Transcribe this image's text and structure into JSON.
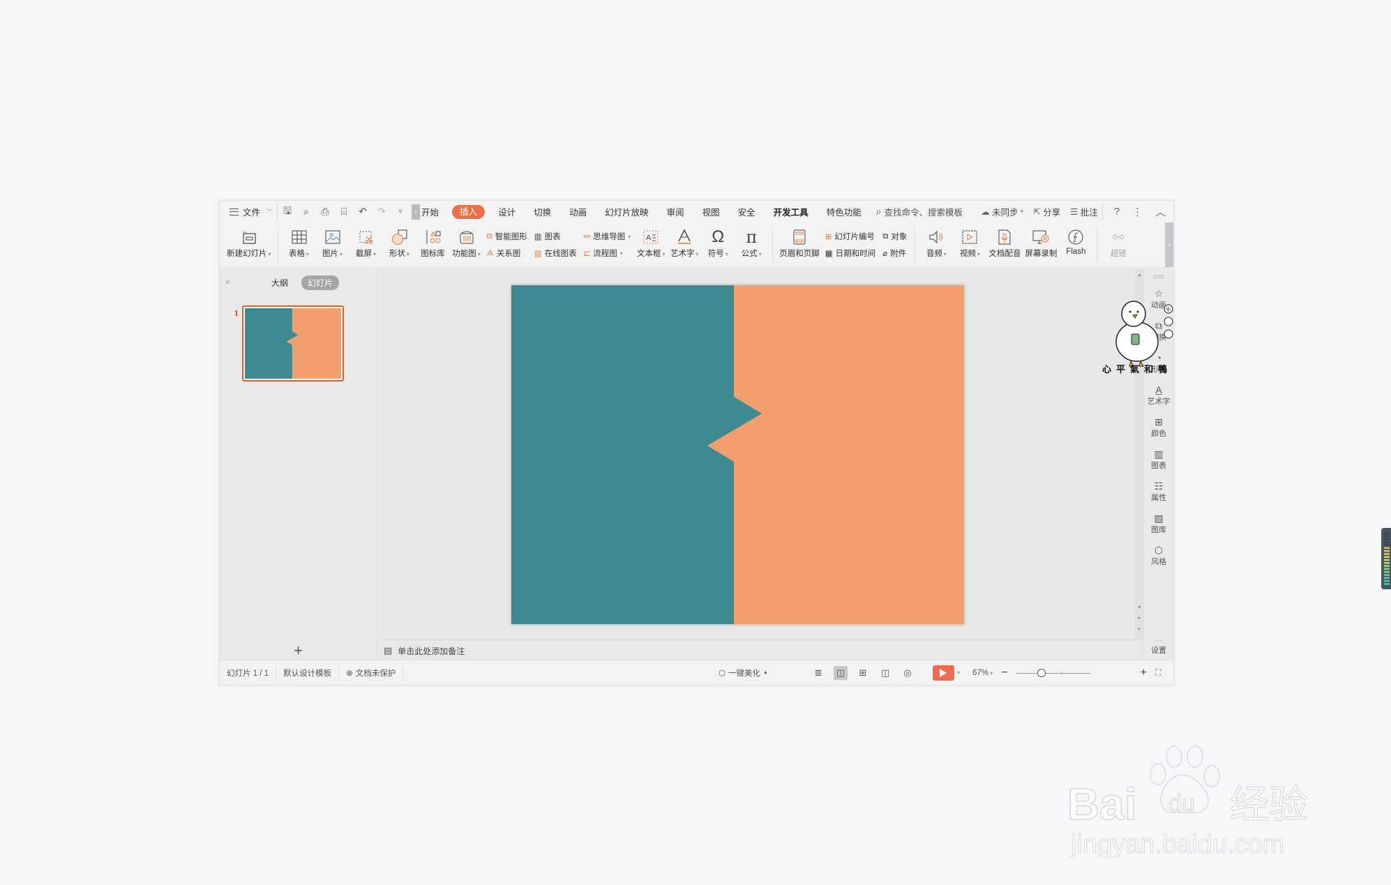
{
  "menubar": {
    "file_label": "文件",
    "tabs": [
      {
        "label": "开始",
        "active": false
      },
      {
        "label": "插入",
        "active": true
      },
      {
        "label": "设计",
        "active": false
      },
      {
        "label": "切换",
        "active": false
      },
      {
        "label": "动画",
        "active": false
      },
      {
        "label": "幻灯片放映",
        "active": false
      },
      {
        "label": "审阅",
        "active": false
      },
      {
        "label": "视图",
        "active": false
      },
      {
        "label": "安全",
        "active": false
      },
      {
        "label": "开发工具",
        "active": false
      },
      {
        "label": "特色功能",
        "active": false
      }
    ],
    "search_label": "查找命令、搜索模板",
    "sync_label": "未同步",
    "share_label": "分享",
    "comment_label": "批注",
    "accent_color": "#e8714a"
  },
  "ribbon": {
    "new_slide": "新建幻灯片",
    "table": "表格",
    "picture": "图片",
    "screenshot": "截屏",
    "shape": "形状",
    "icon_lib": "图标库",
    "function_chart": "功能图",
    "smart_art": "智能图形",
    "relation_chart": "关系图",
    "chart": "图表",
    "online_chart": "在线图表",
    "mind_map": "思维导图",
    "flowchart": "流程图",
    "textbox": "文本框",
    "wordart": "艺术字",
    "symbol": "符号",
    "formula": "公式",
    "header_footer": "页眉和页脚",
    "slide_number": "幻灯片编号",
    "object": "对象",
    "date_time": "日期和时间",
    "attachment": "附件",
    "audio": "音频",
    "video": "视频",
    "doc_voice": "文档配音",
    "screen_record": "屏幕录制",
    "flash": "Flash",
    "hyperlink": "超链"
  },
  "left_panel": {
    "outline_tab": "大纲",
    "slides_tab": "幻灯片",
    "slide_numbers": [
      "1"
    ]
  },
  "slide": {
    "left_color": "#3d8b91",
    "right_color": "#f29e6e"
  },
  "notes": {
    "placeholder": "单击此处添加备注"
  },
  "right_sidebar": {
    "items": [
      "动画",
      "切换",
      "形状",
      "艺术字",
      "颜色",
      "图表",
      "属性",
      "图库",
      "风格"
    ],
    "settings": "设置"
  },
  "sticker": {
    "text": "心平氣和鴨"
  },
  "statusbar": {
    "slide_info": "幻灯片 1 / 1",
    "template": "默认设计模板",
    "protection": "文档未保护",
    "beautify": "一键美化",
    "zoom": "67%",
    "zoom_fraction": 0.36,
    "play_color": "#f06b4f"
  },
  "watermark": {
    "brand": "Bai",
    "brand_du": "du",
    "brand_cn": "经验",
    "url": "jingyan.baidu.com"
  }
}
